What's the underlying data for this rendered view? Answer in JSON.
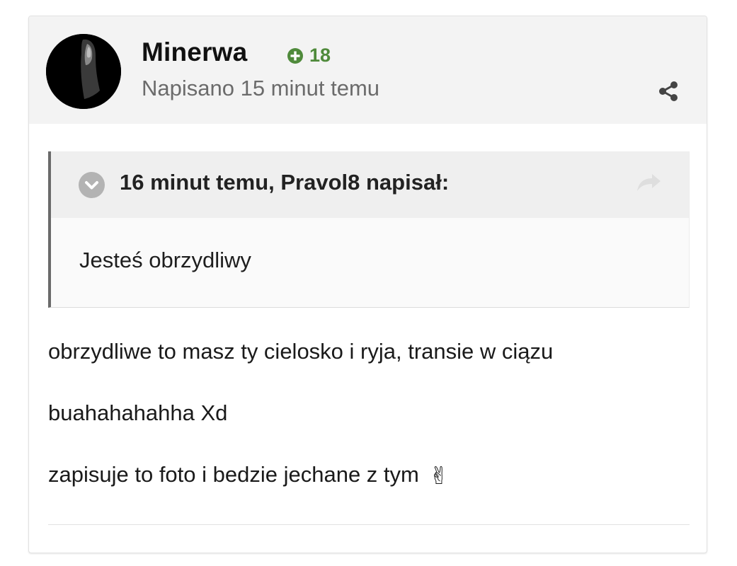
{
  "post": {
    "author": "Minerwa",
    "reputation": "18",
    "date_text": "Napisano 15 minut temu",
    "quote": {
      "citation": "16 minut temu, Pravol8 napisał:",
      "text": "Jesteś obrzydliwy"
    },
    "lines": [
      "obrzydliwe to masz ty cielosko i ryja, transie w ciązu",
      "buahahahahha Xd",
      "zapisuje to foto i bedzie jechane z tym"
    ],
    "emoji": "✌"
  },
  "colors": {
    "reputation_green": "#4f8a3b",
    "header_bg": "#f3f3f3",
    "quote_border": "#6a6a6a"
  },
  "icons": {
    "reputation": "plus-circle-icon",
    "share": "share-icon",
    "quote_toggle": "chevron-down-circle-icon",
    "quote_jump": "reply-arrow-icon"
  }
}
